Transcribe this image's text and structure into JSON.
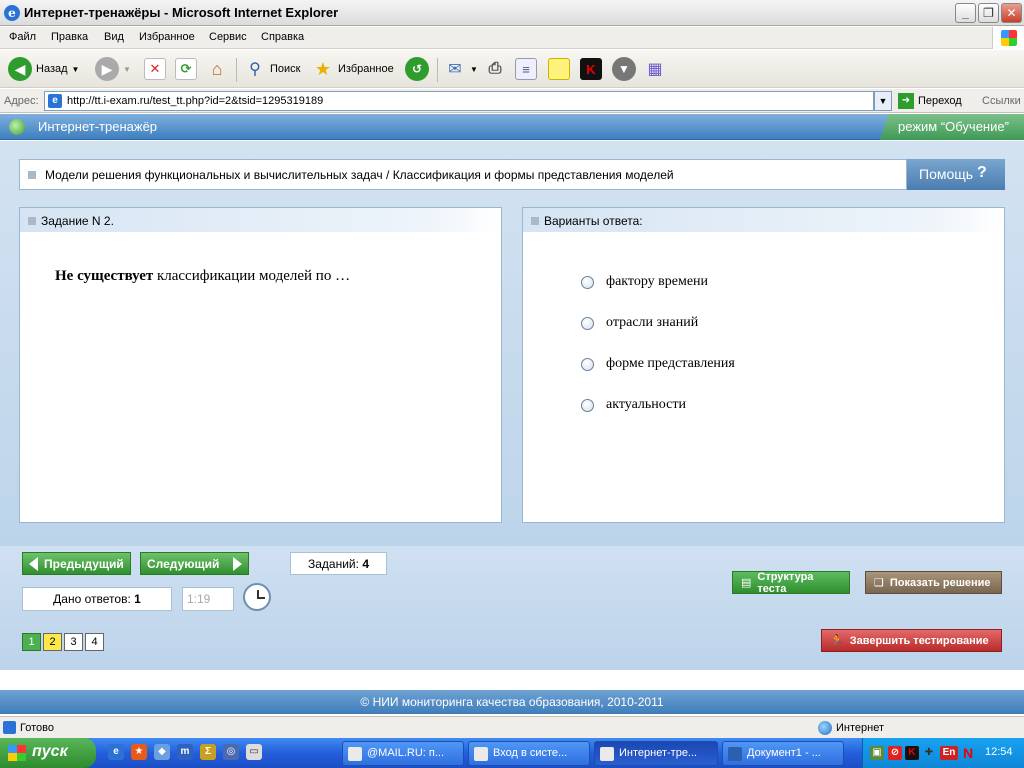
{
  "window": {
    "title": "Интернет-тренажёры - Microsoft Internet Explorer"
  },
  "menu": [
    "Файл",
    "Правка",
    "Вид",
    "Избранное",
    "Сервис",
    "Справка"
  ],
  "toolbar": {
    "back": "Назад",
    "search": "Поиск",
    "favorites": "Избранное"
  },
  "address": {
    "label": "Адрес:",
    "url": "http://tt.i-exam.ru/test_tt.php?id=2&tsid=1295319189",
    "go": "Переход",
    "links": "Ссылки"
  },
  "site": {
    "name": "Интернет-тренажёр",
    "mode": "режим “Обучение”"
  },
  "topic": {
    "text": "Модели решения функциональных и вычислительных задач / Классификация и формы представления моделей",
    "help": "Помощь",
    "help_mark": "?"
  },
  "task": {
    "header": "Задание N 2.",
    "question_bold": "Не существует",
    "question_rest": " классификации моделей по …"
  },
  "answers": {
    "header": "Варианты ответа:",
    "options": [
      "фактору времени",
      "отрасли знаний",
      "форме представления",
      "актуальности"
    ]
  },
  "nav": {
    "prev": "Предыдущий",
    "next": "Следующий",
    "tasks_label": "Заданий:",
    "tasks_count": "4",
    "answered_label": "Дано ответов:",
    "answered_count": "1",
    "timer": "1:19",
    "pages": [
      "1",
      "2",
      "3",
      "4"
    ]
  },
  "actions": {
    "structure": "Структура теста",
    "solution": "Показать решение",
    "finish": "Завершить тестирование"
  },
  "footer": {
    "copyright": "© НИИ мониторинга качества образования, 2010-2011"
  },
  "status": {
    "ready": "Готово",
    "zone": "Интернет"
  },
  "taskbar": {
    "start": "пуск",
    "tasks": [
      "@MAIL.RU: п...",
      "Вход в систе...",
      "Интернет-тре...",
      "Документ1 - ..."
    ],
    "time": "12:54",
    "lang": "En"
  }
}
